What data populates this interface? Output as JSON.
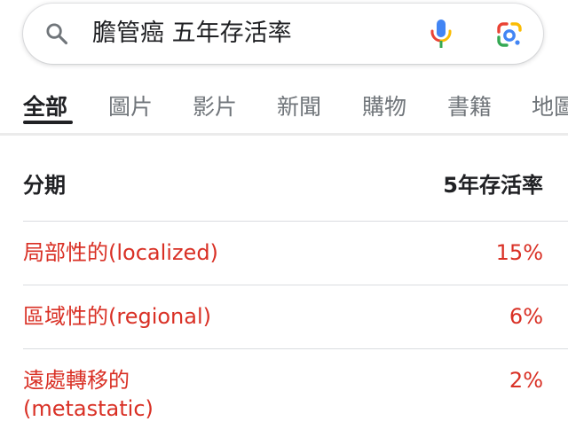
{
  "search": {
    "query": "膽管癌 五年存活率",
    "icons": [
      "search-icon",
      "microphone-icon",
      "google-lens-icon"
    ]
  },
  "tabs": [
    {
      "label": "全部",
      "active": true
    },
    {
      "label": "圖片",
      "active": false
    },
    {
      "label": "影片",
      "active": false
    },
    {
      "label": "新聞",
      "active": false
    },
    {
      "label": "購物",
      "active": false
    },
    {
      "label": "書籍",
      "active": false
    },
    {
      "label": "地圖",
      "active": false
    }
  ],
  "table": {
    "headers": [
      "分期",
      "5年存活率"
    ],
    "rows": [
      {
        "stage": "局部性的(localized)",
        "rate": "15%"
      },
      {
        "stage": "區域性的(regional)",
        "rate": "6%"
      },
      {
        "stage_line1": "遠處轉移的",
        "stage_line2": "(metastatic)",
        "rate": "2%"
      }
    ]
  },
  "colors": {
    "accent_red": "#d93025",
    "text_primary": "#202124",
    "text_secondary": "#70757a",
    "divider": "#dadce0",
    "google_blue": "#4285f4",
    "google_red": "#ea4335",
    "google_yellow": "#fbbc04",
    "google_green": "#34a853"
  }
}
